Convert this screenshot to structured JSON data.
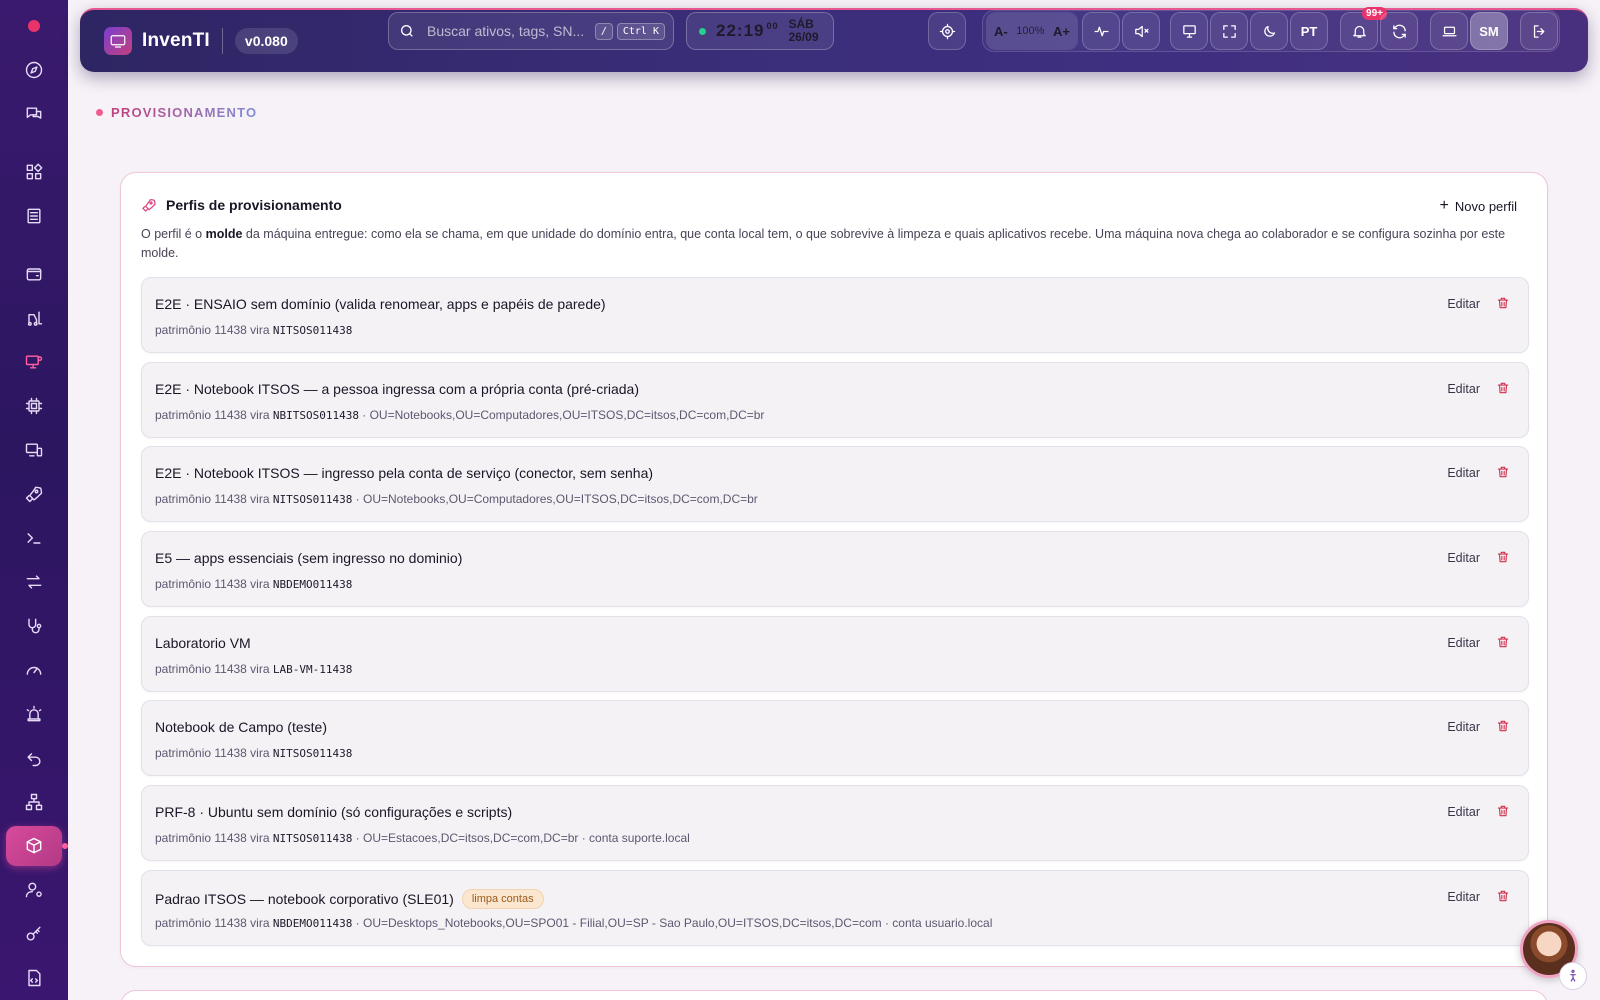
{
  "app": {
    "name": "InvenTI",
    "version": "v0.080"
  },
  "topbar": {
    "search_placeholder": "Buscar ativos, tags, SN...",
    "shortcut_slash": "/",
    "shortcut_ctrl": "Ctrl K",
    "time": "22:19",
    "seconds": "00",
    "day": "SÁB",
    "date": "26/09",
    "zoom_out": "A-",
    "zoom_level": "100%",
    "zoom_in": "A+",
    "language": "PT",
    "notifications": "99+",
    "user_initials": "SM"
  },
  "page": {
    "section_title": "PROVISIONAMENTO",
    "card_title": "Perfis de provisionamento",
    "new_profile_label": "Novo perfil",
    "desc_prefix": "O perfil é o ",
    "desc_bold": "molde",
    "desc_suffix": " da máquina entregue: como ela se chama, em que unidade do domínio entra, que conta local tem, o que sobrevive à limpeza e quais aplicativos recebe. Uma máquina nova chega ao colaborador e se configura sozinha por este molde.",
    "edit_label": "Editar"
  },
  "profiles": [
    {
      "title": "E2E · ENSAIO sem domínio (valida renomear, apps e papéis de parede)",
      "tag": "",
      "prefix": "patrimônio 11438 vira ",
      "name": "NITSOS011438",
      "details": ""
    },
    {
      "title": "E2E · Notebook ITSOS — a pessoa ingressa com a própria conta (pré-criada)",
      "tag": "",
      "prefix": "patrimônio 11438 vira ",
      "name": "NBITSOS011438",
      "details": " · OU=Notebooks,OU=Computadores,OU=ITSOS,DC=itsos,DC=com,DC=br"
    },
    {
      "title": "E2E · Notebook ITSOS — ingresso pela conta de serviço (conector, sem senha)",
      "tag": "",
      "prefix": "patrimônio 11438 vira ",
      "name": "NITSOS011438",
      "details": " · OU=Notebooks,OU=Computadores,OU=ITSOS,DC=itsos,DC=com,DC=br"
    },
    {
      "title": "E5 — apps essenciais (sem ingresso no dominio)",
      "tag": "",
      "prefix": "patrimônio 11438 vira ",
      "name": "NBDEMO011438",
      "details": ""
    },
    {
      "title": "Laboratorio VM",
      "tag": "",
      "prefix": "patrimônio 11438 vira ",
      "name": "LAB-VM-11438",
      "details": ""
    },
    {
      "title": "Notebook de Campo (teste)",
      "tag": "",
      "prefix": "patrimônio 11438 vira ",
      "name": "NITSOS011438",
      "details": ""
    },
    {
      "title": "PRF-8 · Ubuntu sem domínio (só configurações e scripts)",
      "tag": "",
      "prefix": "patrimônio 11438 vira ",
      "name": "NITSOS011438",
      "details": " · OU=Estacoes,DC=itsos,DC=com,DC=br · conta suporte.local"
    },
    {
      "title": "Padrao ITSOS — notebook corporativo (SLE01)",
      "tag": "limpa contas",
      "prefix": "patrimônio 11438 vira ",
      "name": "NBDEMO011438",
      "details": " · OU=Desktops_Notebooks,OU=SPO01 - Filial,OU=SP - Sao Paulo,OU=ITSOS,DC=itsos,DC=com · conta usuario.local"
    }
  ],
  "colors": {
    "accent": "#d8407e",
    "sidebar": "#2c1660",
    "danger": "#d12f4b"
  }
}
